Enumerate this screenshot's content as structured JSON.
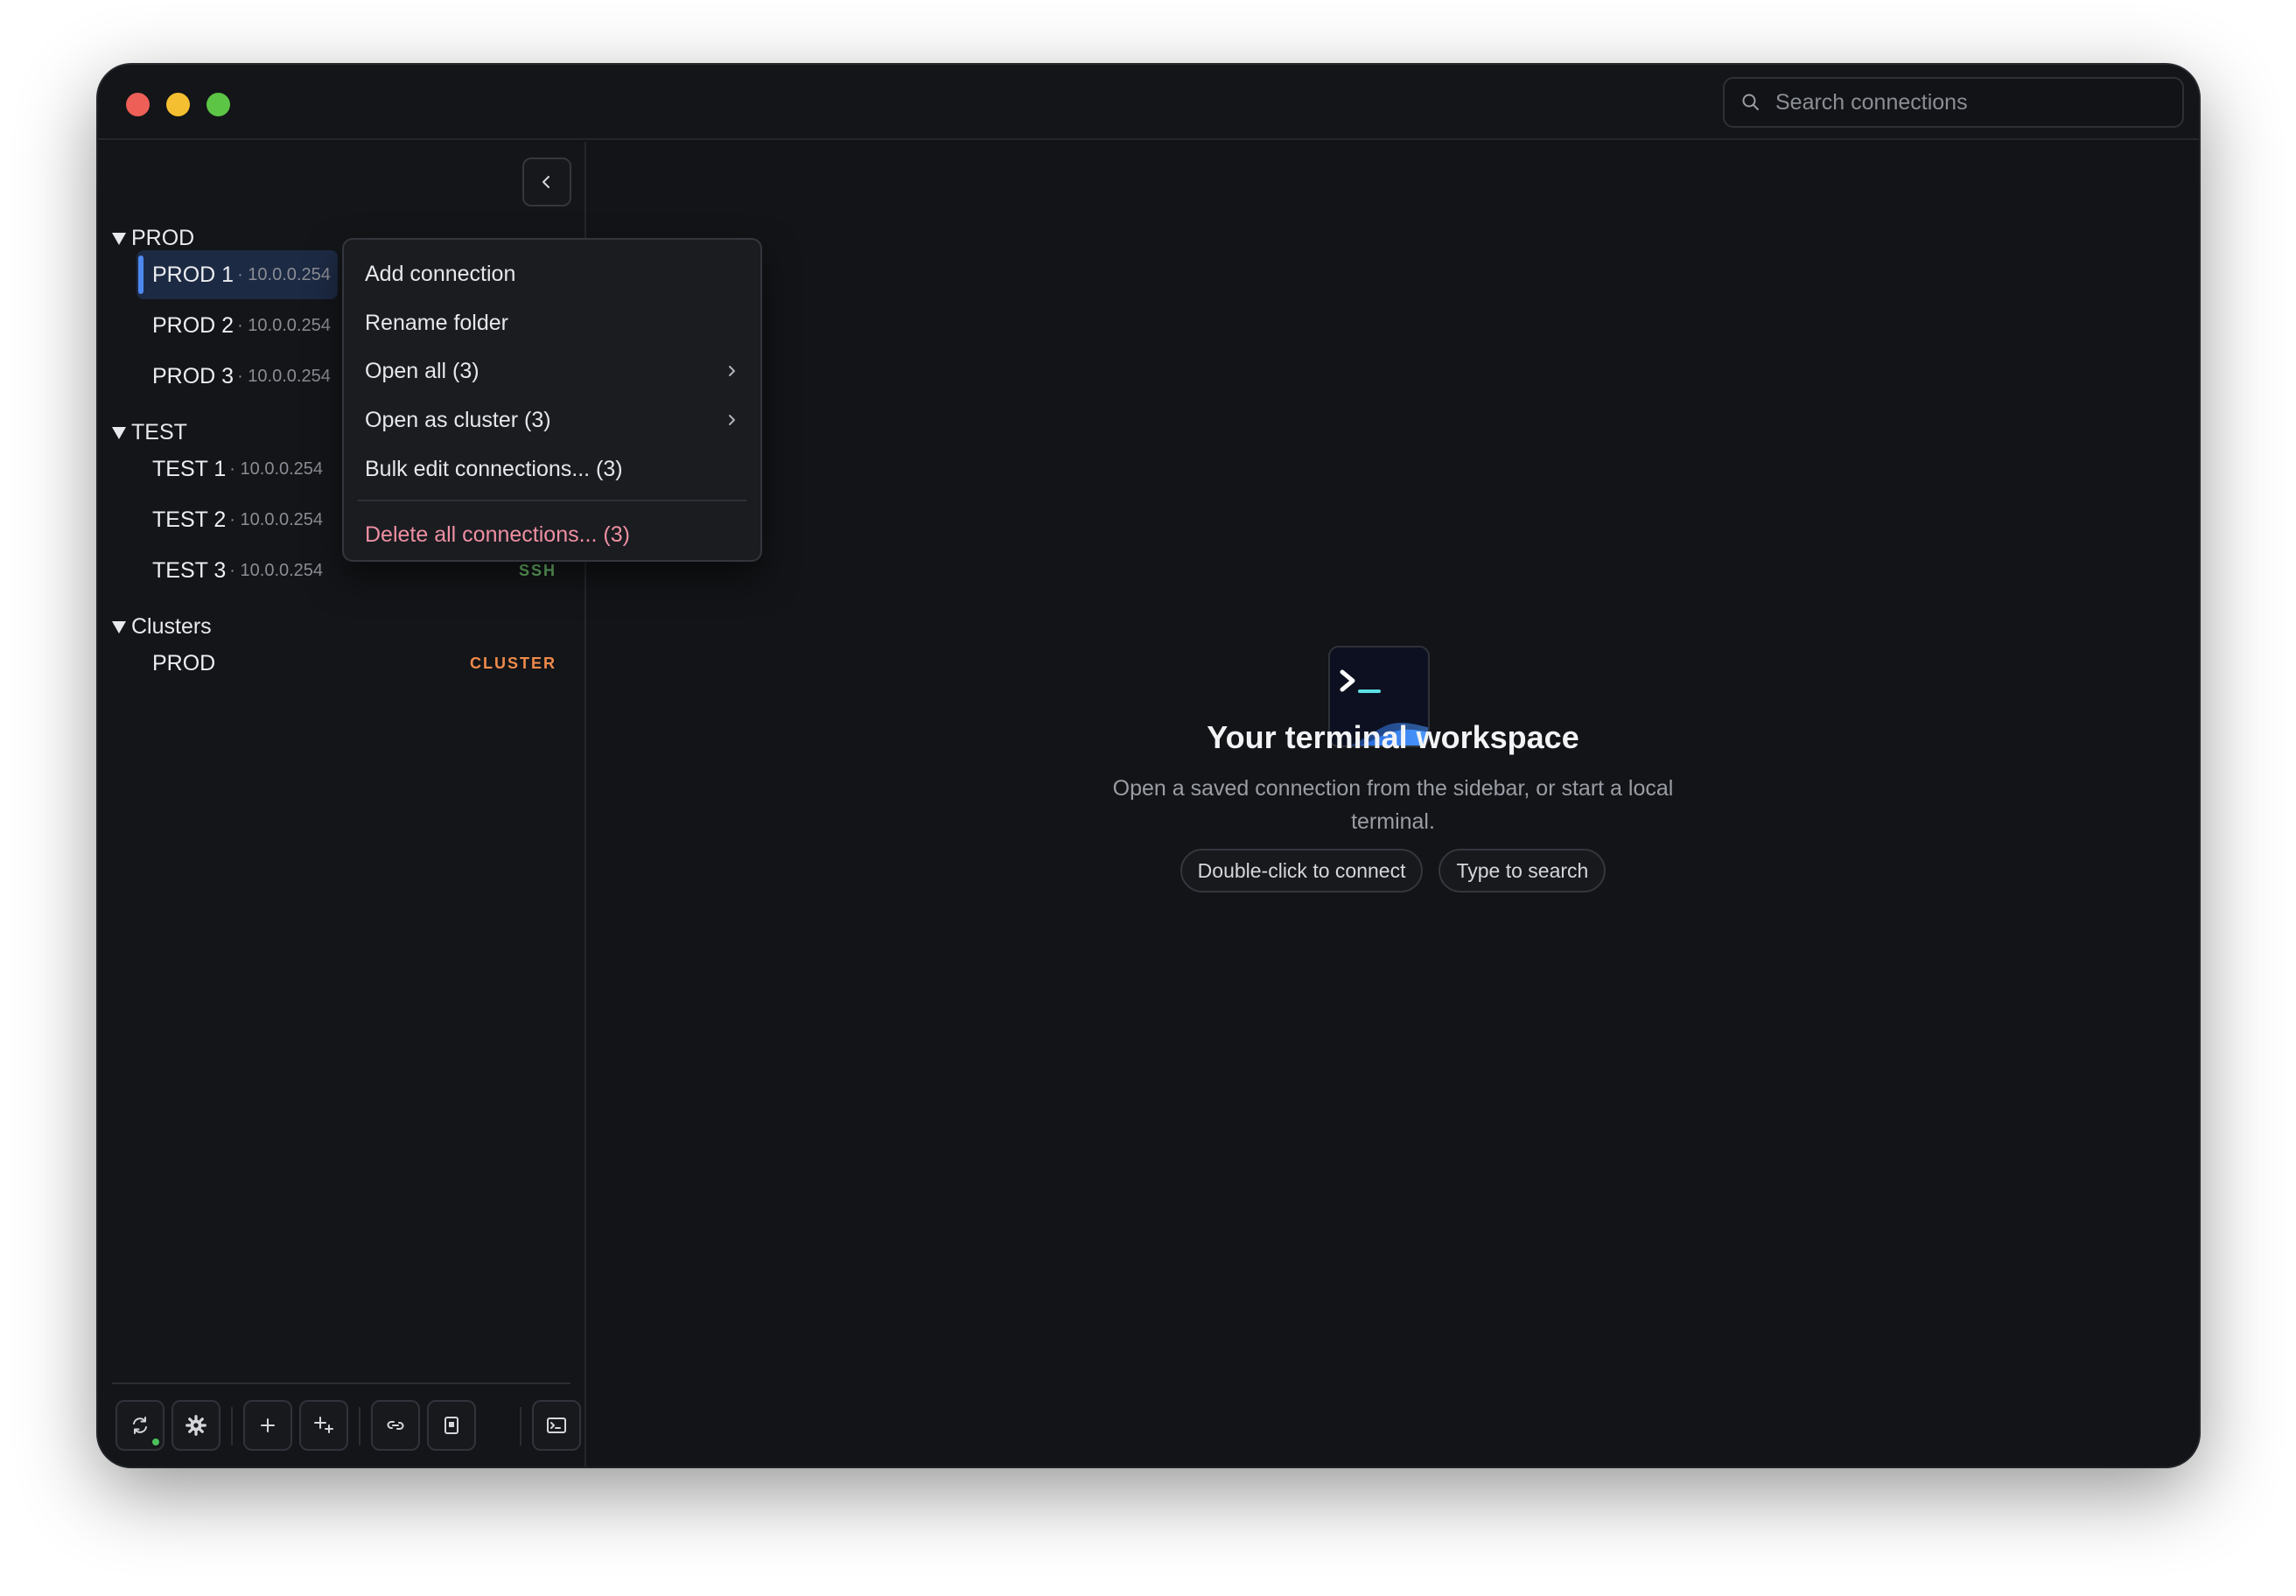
{
  "search": {
    "placeholder": "Search connections"
  },
  "sidebar": {
    "folders": [
      {
        "label": "PROD",
        "connections": [
          {
            "name": "PROD 1",
            "host": "· 10.0.0.254",
            "selected": true
          },
          {
            "name": "PROD 2",
            "host": "· 10.0.0.254"
          },
          {
            "name": "PROD 3",
            "host": "· 10.0.0.254"
          }
        ]
      },
      {
        "label": "TEST",
        "connections": [
          {
            "name": "TEST 1",
            "host": "· 10.0.0.254"
          },
          {
            "name": "TEST 2",
            "host": "· 10.0.0.254"
          },
          {
            "name": "TEST 3",
            "host": "· 10.0.0.254",
            "tag": "SSH"
          }
        ]
      },
      {
        "label": "Clusters",
        "connections": [
          {
            "name": "PROD",
            "host": "",
            "tag": "CLUSTER"
          }
        ]
      }
    ]
  },
  "context_menu": {
    "items": [
      {
        "label": "Add connection"
      },
      {
        "label": "Rename folder"
      },
      {
        "label": "Open all (3)",
        "submenu": true
      },
      {
        "label": "Open as cluster (3)",
        "submenu": true
      },
      {
        "label": "Bulk edit connections... (3)"
      },
      {
        "label": "Delete all connections... (3)",
        "danger": true
      }
    ]
  },
  "empty_state": {
    "title": "Your terminal workspace",
    "subtitle": "Open a saved connection from the sidebar, or start a local terminal.",
    "chips": [
      "Double-click to connect",
      "Type to search"
    ]
  },
  "toolbar": {
    "icons": [
      "sync-icon",
      "gear-icon",
      "plus-icon",
      "add-sparkle-icon",
      "link-icon",
      "bookmark-icon",
      "terminal-icon"
    ]
  },
  "colors": {
    "accent": "#4d88f0",
    "ssh": "#6bb86a",
    "cluster": "#f08a4b",
    "danger": "#ef8fa2",
    "status_online": "#4cc25a"
  }
}
